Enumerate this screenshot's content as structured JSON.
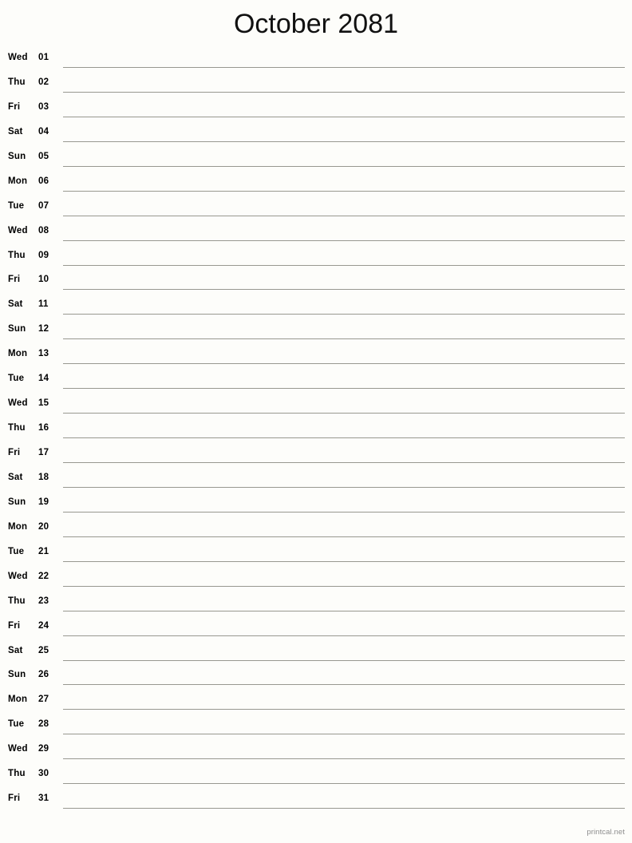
{
  "page": {
    "title": "October 2081",
    "background_color": "#fdfdfa",
    "rule_color": "#989890",
    "text_color": "#000000"
  },
  "footer": {
    "label": "printcal.net",
    "color": "#8d8d8d"
  },
  "calendar": {
    "month": "October",
    "year": "2081",
    "days": [
      {
        "weekday": "Wed",
        "date": "01"
      },
      {
        "weekday": "Thu",
        "date": "02"
      },
      {
        "weekday": "Fri",
        "date": "03"
      },
      {
        "weekday": "Sat",
        "date": "04"
      },
      {
        "weekday": "Sun",
        "date": "05"
      },
      {
        "weekday": "Mon",
        "date": "06"
      },
      {
        "weekday": "Tue",
        "date": "07"
      },
      {
        "weekday": "Wed",
        "date": "08"
      },
      {
        "weekday": "Thu",
        "date": "09"
      },
      {
        "weekday": "Fri",
        "date": "10"
      },
      {
        "weekday": "Sat",
        "date": "11"
      },
      {
        "weekday": "Sun",
        "date": "12"
      },
      {
        "weekday": "Mon",
        "date": "13"
      },
      {
        "weekday": "Tue",
        "date": "14"
      },
      {
        "weekday": "Wed",
        "date": "15"
      },
      {
        "weekday": "Thu",
        "date": "16"
      },
      {
        "weekday": "Fri",
        "date": "17"
      },
      {
        "weekday": "Sat",
        "date": "18"
      },
      {
        "weekday": "Sun",
        "date": "19"
      },
      {
        "weekday": "Mon",
        "date": "20"
      },
      {
        "weekday": "Tue",
        "date": "21"
      },
      {
        "weekday": "Wed",
        "date": "22"
      },
      {
        "weekday": "Thu",
        "date": "23"
      },
      {
        "weekday": "Fri",
        "date": "24"
      },
      {
        "weekday": "Sat",
        "date": "25"
      },
      {
        "weekday": "Sun",
        "date": "26"
      },
      {
        "weekday": "Mon",
        "date": "27"
      },
      {
        "weekday": "Tue",
        "date": "28"
      },
      {
        "weekday": "Wed",
        "date": "29"
      },
      {
        "weekday": "Thu",
        "date": "30"
      },
      {
        "weekday": "Fri",
        "date": "31"
      }
    ]
  }
}
